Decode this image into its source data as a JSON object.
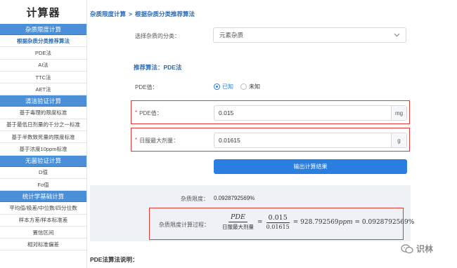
{
  "sidebar": {
    "title": "计算器",
    "groups": [
      {
        "header": "杂质限度计算",
        "items": [
          {
            "label": "根据杂质分类推荐算法",
            "active": true
          },
          {
            "label": "PDE法"
          },
          {
            "label": "AI法"
          },
          {
            "label": "TTC法"
          },
          {
            "label": "AET法"
          }
        ]
      },
      {
        "header": "清洁验证计算",
        "items": [
          {
            "label": "基于毒理的限度标准"
          },
          {
            "label": "基于最低日剂量的千分之一标准"
          },
          {
            "label": "基于半数致死量的限度标准"
          },
          {
            "label": "基于浓度10ppm标准"
          }
        ]
      },
      {
        "header": "无菌验证计算",
        "items": [
          {
            "label": "D值"
          },
          {
            "label": "Fo值"
          }
        ]
      },
      {
        "header": "统计学基础计算",
        "items": [
          {
            "label": "平均值/极差/中位数/四分位数"
          },
          {
            "label": "样本方差/样本标准差"
          },
          {
            "label": "置信区间"
          },
          {
            "label": "相对标准偏差"
          }
        ]
      }
    ]
  },
  "breadcrumb": {
    "root": "杂质限度计算",
    "separator": ">",
    "current": "根据杂质分类推荐算法"
  },
  "form": {
    "category_label": "选择杂质的分类：",
    "category_value": "元素杂质",
    "recommend_title": "推荐算法：PDE法",
    "pde_known_label": "PDE值：",
    "radio_known": "已知",
    "radio_unknown": "未知",
    "pde_label": "PDE值：",
    "pde_value": "0.015",
    "pde_unit": "mg",
    "dose_label": "日服最大剂量：",
    "dose_value": "0.01615",
    "dose_unit": "g",
    "submit_label": "输出计算结果",
    "required_mark": "*"
  },
  "result": {
    "limit_label": "杂质限度：",
    "limit_value": "0.0928792569%",
    "process_label": "杂质限度计算过程：",
    "f1_num": "PDE",
    "f1_den": "日服最大剂量",
    "f2_num": "0.015",
    "f2_den": "0.01615",
    "eq_rest_a": "= 928.792569",
    "eq_unit": "ppm",
    "eq_rest_b": "= 0.0928792569%"
  },
  "bottom_heading": "PDE法算法说明：",
  "watermark": "识林",
  "colors": {
    "accent": "#2a7de1",
    "sidebar_header": "#4a8fd8",
    "highlight_border": "#e53935"
  }
}
